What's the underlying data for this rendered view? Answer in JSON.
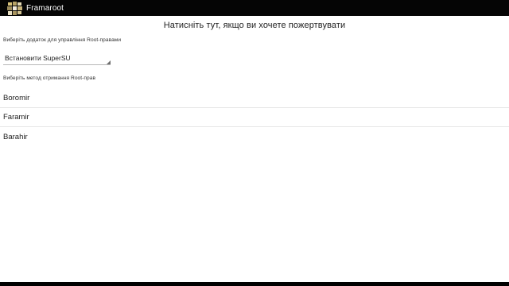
{
  "app": {
    "title": "Framaroot",
    "icon": "framaroot-app-icon"
  },
  "donate_text": "Натисніть тут, якщо ви хочете пожертвувати",
  "root_app": {
    "label": "Виберіть додаток для управління Root-правами",
    "selected": "Встановити SuperSU"
  },
  "method": {
    "label": "Виберіть метод отримання Root-прав"
  },
  "exploits": [
    {
      "label": "Boromir"
    },
    {
      "label": "Faramir"
    },
    {
      "label": "Barahir"
    }
  ],
  "colors": {
    "titlebar": "#050505",
    "background": "#ffffff",
    "text": "#222222",
    "divider": "#e6e6e6"
  }
}
